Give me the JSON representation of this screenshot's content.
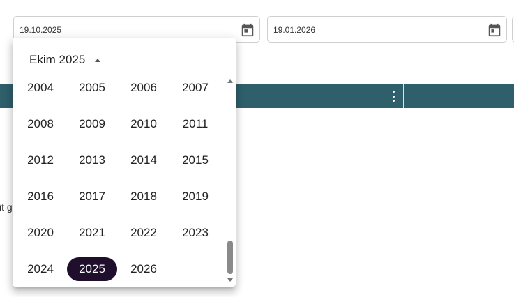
{
  "filters": {
    "start_date": "19.10.2025",
    "end_date": "19.01.2026",
    "calendar_icon": "calendar-icon"
  },
  "background": {
    "partial_text": "it g",
    "table_header_color": "#2e5f6b"
  },
  "picker": {
    "title": "Ekim 2025",
    "selected_color": "#1f0f2c",
    "years": [
      "2004",
      "2005",
      "2006",
      "2007",
      "2008",
      "2009",
      "2010",
      "2011",
      "2012",
      "2013",
      "2014",
      "2015",
      "2016",
      "2017",
      "2018",
      "2019",
      "2020",
      "2021",
      "2022",
      "2023",
      "2024",
      "2025",
      "2026"
    ],
    "selected_year": "2025"
  }
}
